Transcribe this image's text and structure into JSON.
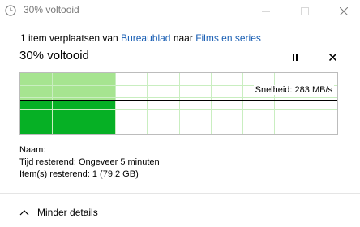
{
  "window": {
    "title": "30% voltooid"
  },
  "operation": {
    "prefix": "1 item verplaatsen van",
    "source": "Bureaublad",
    "middle": "naar",
    "destination": "Films en series"
  },
  "progress": {
    "heading": "30% voltooid",
    "percent": 30
  },
  "graph": {
    "speed_label": "Snelheid: 283 MB/s",
    "colors": {
      "fill_light": "#a6e490",
      "fill_dark": "#06b025",
      "grid": "#c9eec0",
      "line": "#000000"
    }
  },
  "details": {
    "name_label": "Naam:",
    "name_value": "",
    "time_label": "Tijd resterend:",
    "time_value": "Ongeveer 5 minuten",
    "items_label": "Item(s) resterend:",
    "items_value": "1 (79,2 GB)"
  },
  "footer": {
    "toggle_label": "Minder details"
  },
  "icons": {
    "title": "clock-icon",
    "pause": "pause-icon",
    "cancel": "close-icon",
    "toggle": "chevron-up-icon"
  }
}
